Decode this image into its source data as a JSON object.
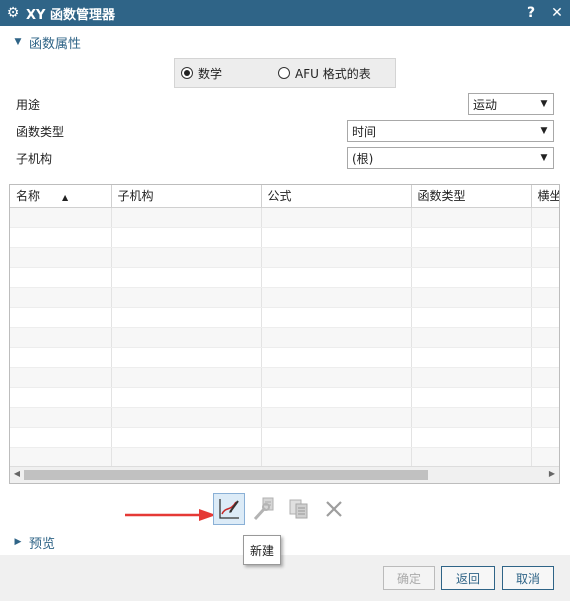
{
  "window": {
    "title": "XY 函数管理器",
    "help": "?",
    "close": "✕"
  },
  "props": {
    "header": "函数属性",
    "radio_math": "数学",
    "radio_afu": "AFU 格式的表",
    "use_label": "用途",
    "use_value": "运动",
    "type_label": "函数类型",
    "type_value": "时间",
    "sub_label": "子机构",
    "sub_value": "(根)"
  },
  "table": {
    "columns": [
      "名称",
      "子机构",
      "公式",
      "函数类型",
      "横坐"
    ]
  },
  "toolbar": {
    "tooltip": "新建"
  },
  "preview": {
    "header": "预览"
  },
  "footer": {
    "ok": "确定",
    "apply": "返回",
    "cancel": "取消"
  },
  "colors": {
    "accent": "#2f6487",
    "arrow": "#e53935"
  }
}
